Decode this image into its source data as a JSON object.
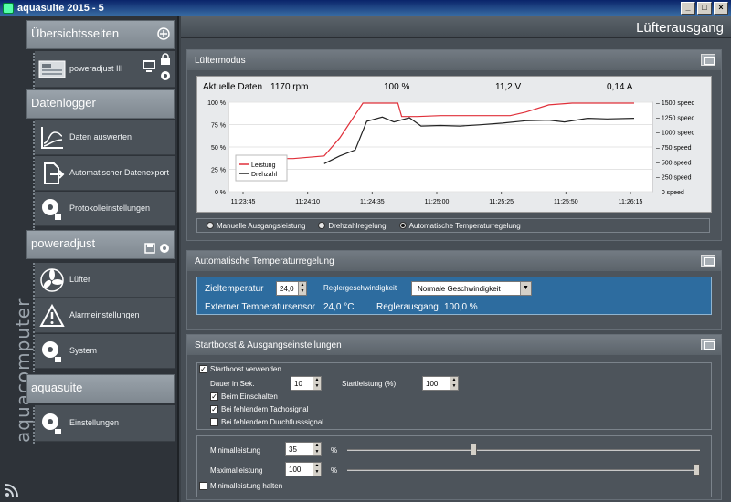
{
  "window": {
    "title": "aquasuite 2015 - 5"
  },
  "sidebar": {
    "brand": "aquacomputer",
    "sections": [
      {
        "label": "Übersichtsseiten"
      },
      {
        "label": "Datenlogger"
      },
      {
        "label": "poweradjust"
      },
      {
        "label": "aquasuite"
      }
    ],
    "items": [
      {
        "label": "poweradjust III"
      },
      {
        "label": "Daten auswerten"
      },
      {
        "label": "Automatischer Datenexport"
      },
      {
        "label": "Protokolleinstellungen"
      },
      {
        "label": "Lüfter"
      },
      {
        "label": "Alarmeinstellungen"
      },
      {
        "label": "System"
      },
      {
        "label": "Einstellungen"
      }
    ]
  },
  "main": {
    "title": "Lüfterausgang"
  },
  "fan_mode": {
    "title": "Lüftermodus",
    "current_label": "Aktuelle Daten",
    "rpm": "1170 rpm",
    "percent": "100 %",
    "voltage": "11,2 V",
    "current": "0,14 A",
    "radios": [
      {
        "label": "Manuelle Ausgangsleistung",
        "selected": false
      },
      {
        "label": "Drehzahlregelung",
        "selected": false
      },
      {
        "label": "Automatische Temperaturregelung",
        "selected": true
      }
    ]
  },
  "chart_data": {
    "type": "line",
    "x": [
      "11:23:45",
      "11:24:10",
      "11:24:35",
      "11:25:00",
      "11:25:25",
      "11:25:50",
      "11:26:15"
    ],
    "left_axis_ticks": [
      "0 %",
      "25 %",
      "50 %",
      "75 %",
      "100 %"
    ],
    "right_axis_ticks": [
      "0 speed",
      "250 speed",
      "500 speed",
      "750 speed",
      "1000 speed",
      "1250 speed",
      "1500 speed"
    ],
    "ylim_left": [
      0,
      100
    ],
    "ylim_right": [
      0,
      1500
    ],
    "series": [
      {
        "name": "Leistung",
        "color": "#e0303a",
        "axis": "left",
        "points": [
          [
            0,
            37
          ],
          [
            0.12,
            37
          ],
          [
            0.2,
            40
          ],
          [
            0.24,
            60
          ],
          [
            0.3,
            99
          ],
          [
            0.39,
            99
          ],
          [
            0.4,
            84
          ],
          [
            0.44,
            84
          ],
          [
            0.5,
            85
          ],
          [
            0.6,
            85
          ],
          [
            0.68,
            85
          ],
          [
            0.72,
            89
          ],
          [
            0.78,
            97
          ],
          [
            0.84,
            99
          ],
          [
            1.0,
            99
          ]
        ]
      },
      {
        "name": "Drehzahl",
        "color": "#222222",
        "axis": "right",
        "points": [
          [
            0.2,
            470
          ],
          [
            0.24,
            600
          ],
          [
            0.28,
            700
          ],
          [
            0.31,
            1180
          ],
          [
            0.35,
            1250
          ],
          [
            0.38,
            1170
          ],
          [
            0.42,
            1240
          ],
          [
            0.45,
            1100
          ],
          [
            0.5,
            1110
          ],
          [
            0.55,
            1100
          ],
          [
            0.6,
            1120
          ],
          [
            0.66,
            1150
          ],
          [
            0.72,
            1190
          ],
          [
            0.78,
            1200
          ],
          [
            0.82,
            1170
          ],
          [
            0.88,
            1230
          ],
          [
            0.93,
            1220
          ],
          [
            1.0,
            1230
          ]
        ]
      }
    ]
  },
  "auto_temp": {
    "title": "Automatische Temperaturregelung",
    "target_label": "Zieltemperatur",
    "target_value": "24,0",
    "speed_label": "Reglergeschwindigkeit",
    "speed_value": "Normale Geschwindigkeit",
    "ext_label": "Externer Temperatursensor",
    "ext_value": "24,0 °C",
    "out_label": "Reglerausgang",
    "out_value": "100,0 %"
  },
  "boost": {
    "title": "Startboost & Ausgangseinstellungen",
    "use_label": "Startboost verwenden",
    "duration_label": "Dauer in Sek.",
    "duration_value": "10",
    "power_label": "Startleistung (%)",
    "power_value": "100",
    "opt1": "Beim Einschalten",
    "opt2": "Bei fehlendem Tachosignal",
    "opt3": "Bei fehlendem Durchflusssignal",
    "min_label": "Minimalleistung",
    "min_value": "35",
    "max_label": "Maximalleistung",
    "max_value": "100",
    "pct": "%",
    "hold_label": "Minimalleistung halten"
  }
}
